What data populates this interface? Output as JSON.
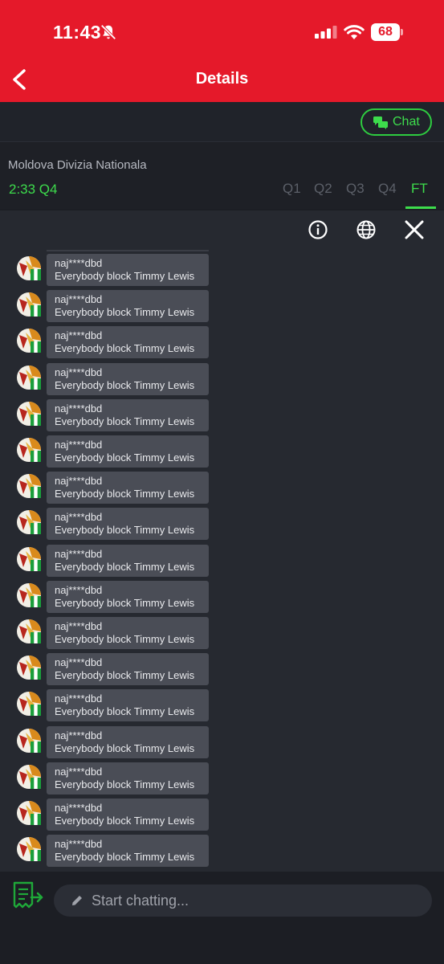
{
  "status_bar": {
    "time": "11:43",
    "battery": "68"
  },
  "header": {
    "title": "Details"
  },
  "chat_button": {
    "label": "Chat"
  },
  "match": {
    "league": "Moldova Divizia Nationala",
    "clock": "2:33 Q4",
    "periods": [
      "Q1",
      "Q2",
      "Q3",
      "Q4",
      "FT"
    ],
    "active_period": "FT"
  },
  "toolbar": {
    "icons": [
      "info-icon",
      "globe-icon",
      "close-icon"
    ]
  },
  "messages": [
    {
      "user": "naj****dbd",
      "text": "Everybody block Timmy Lewis"
    },
    {
      "user": "naj****dbd",
      "text": "Everybody block Timmy Lewis"
    },
    {
      "user": "naj****dbd",
      "text": "Everybody block Timmy Lewis"
    },
    {
      "user": "naj****dbd",
      "text": "Everybody block Timmy Lewis"
    },
    {
      "user": "naj****dbd",
      "text": "Everybody block Timmy Lewis"
    },
    {
      "user": "naj****dbd",
      "text": "Everybody block Timmy Lewis"
    },
    {
      "user": "naj****dbd",
      "text": "Everybody block Timmy Lewis"
    },
    {
      "user": "naj****dbd",
      "text": "Everybody block Timmy Lewis"
    },
    {
      "user": "naj****dbd",
      "text": "Everybody block Timmy Lewis"
    },
    {
      "user": "naj****dbd",
      "text": "Everybody block Timmy Lewis"
    },
    {
      "user": "naj****dbd",
      "text": "Everybody block Timmy Lewis"
    },
    {
      "user": "naj****dbd",
      "text": "Everybody block Timmy Lewis"
    },
    {
      "user": "naj****dbd",
      "text": "Everybody block Timmy Lewis"
    },
    {
      "user": "naj****dbd",
      "text": "Everybody block Timmy Lewis"
    },
    {
      "user": "naj****dbd",
      "text": "Everybody block Timmy Lewis"
    },
    {
      "user": "naj****dbd",
      "text": "Everybody block Timmy Lewis"
    },
    {
      "user": "naj****dbd",
      "text": "Everybody block Timmy Lewis"
    }
  ],
  "composer": {
    "placeholder": "Start chatting..."
  },
  "colors": {
    "brand_red": "#e5192a",
    "accent_green": "#3ddc4c",
    "background": "#262930",
    "bubble": "#4a4d56"
  }
}
